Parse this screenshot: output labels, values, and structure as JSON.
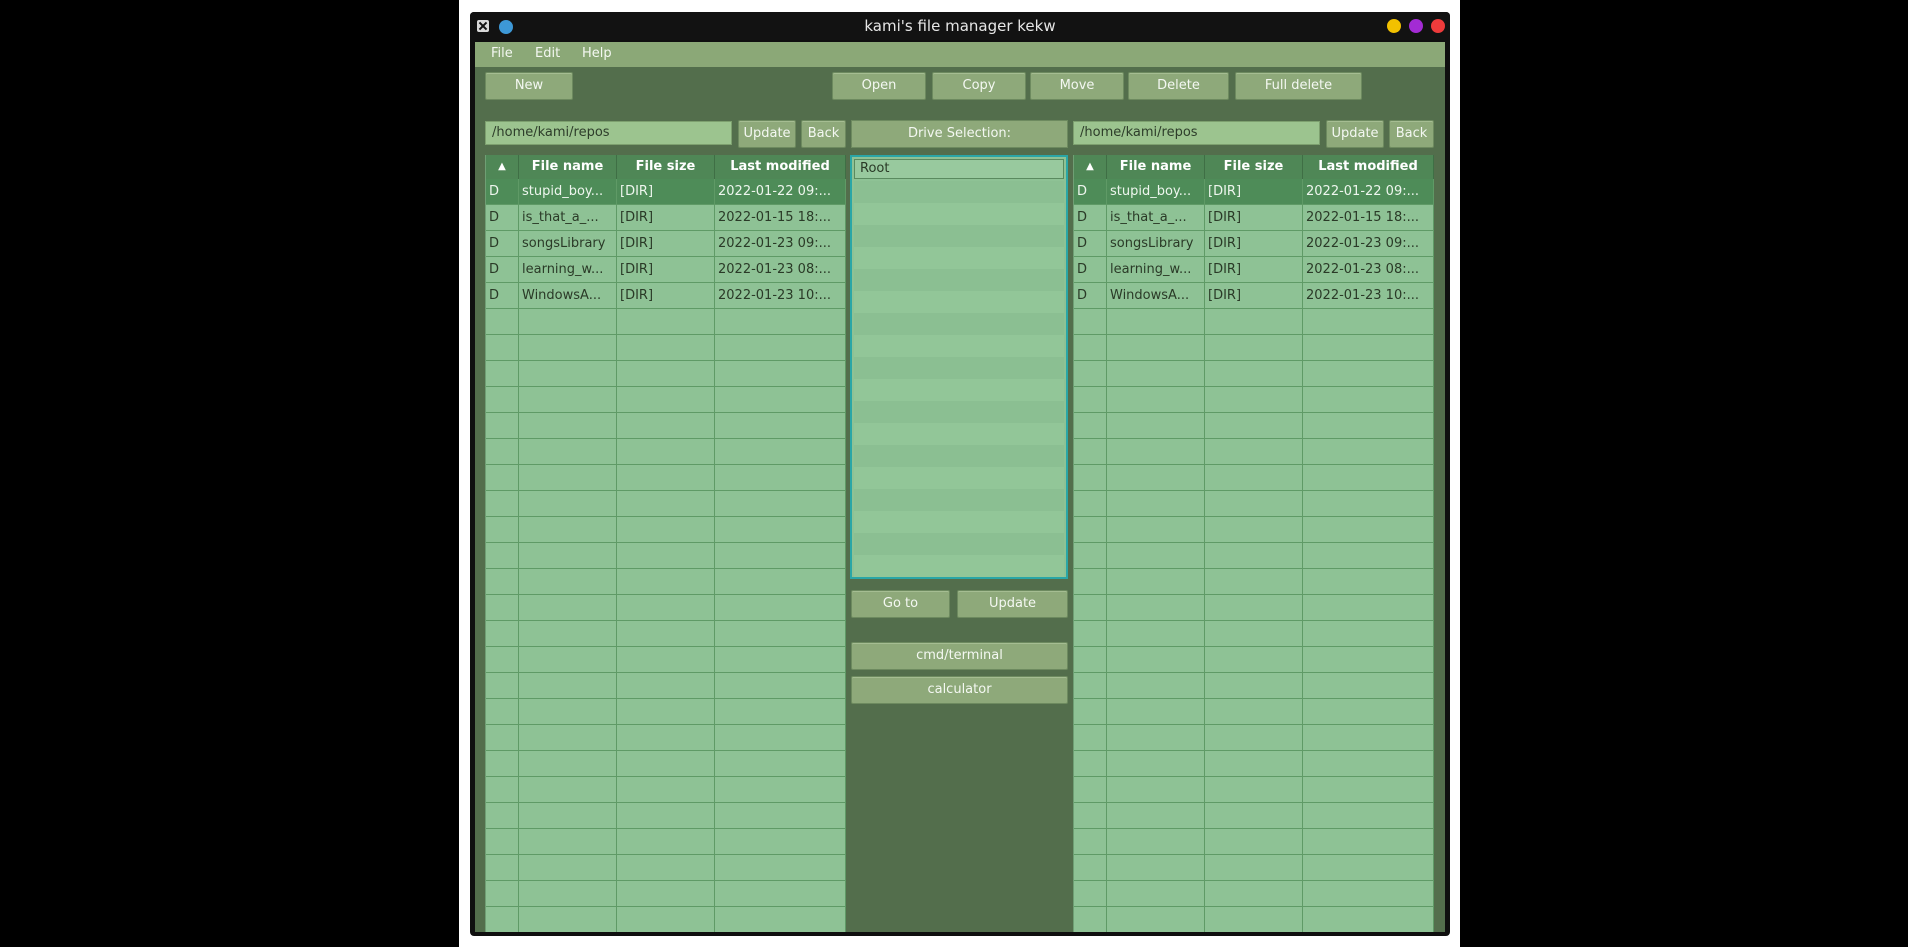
{
  "window": {
    "title": "kami's file manager kekw"
  },
  "menu": [
    "File",
    "Edit",
    "Help"
  ],
  "toolbar": {
    "new": "New",
    "open": "Open",
    "copy": "Copy",
    "move": "Move",
    "delete": "Delete",
    "full_delete": "Full delete"
  },
  "left_panel": {
    "path": "/home/kami/repos",
    "update": "Update",
    "back": "Back",
    "sort_indicator": "▲",
    "columns": [
      "File name",
      "File size",
      "Last modified"
    ],
    "rows": [
      [
        "D",
        "stupid_boy...",
        "[DIR]",
        "2022-01-22 09:..."
      ],
      [
        "D",
        "is_that_a_...",
        "[DIR]",
        "2022-01-15 18:..."
      ],
      [
        "D",
        "songsLibrary",
        "[DIR]",
        "2022-01-23 09:..."
      ],
      [
        "D",
        "learning_w...",
        "[DIR]",
        "2022-01-23 08:..."
      ],
      [
        "D",
        "WindowsA...",
        "[DIR]",
        "2022-01-23 10:..."
      ]
    ]
  },
  "right_panel": {
    "path": "/home/kami/repos",
    "update": "Update",
    "back": "Back",
    "sort_indicator": "▲",
    "columns": [
      "File name",
      "File size",
      "Last modified"
    ],
    "rows": [
      [
        "D",
        "stupid_boy...",
        "[DIR]",
        "2022-01-22 09:..."
      ],
      [
        "D",
        "is_that_a_...",
        "[DIR]",
        "2022-01-15 18:..."
      ],
      [
        "D",
        "songsLibrary",
        "[DIR]",
        "2022-01-23 09:..."
      ],
      [
        "D",
        "learning_w...",
        "[DIR]",
        "2022-01-23 08:..."
      ],
      [
        "D",
        "WindowsA...",
        "[DIR]",
        "2022-01-23 10:..."
      ]
    ]
  },
  "drives": {
    "label": "Drive Selection:",
    "items": [
      "Root"
    ],
    "goto": "Go to",
    "update": "Update"
  },
  "tools": {
    "terminal": "cmd/terminal",
    "calculator": "calculator"
  },
  "colors": {
    "background": "#536e4c",
    "table": "#8ec295",
    "header": "#4f8756",
    "button": "#8ea97a",
    "accent": "#2aa6a6"
  }
}
